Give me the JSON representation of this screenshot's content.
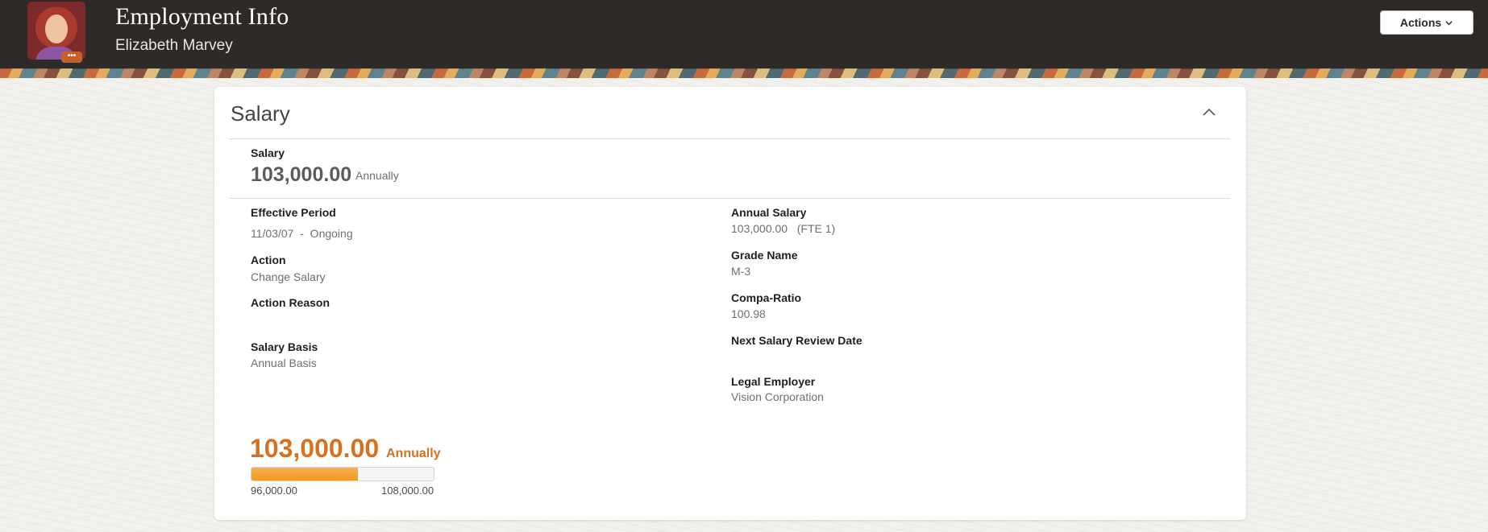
{
  "header": {
    "title": "Employment Info",
    "person_name": "Elizabeth Marvey",
    "actions_label": "Actions",
    "avatar_badge": "•••"
  },
  "section": {
    "title": "Salary",
    "salary_label": "Salary",
    "salary_amount": "103,000.00",
    "salary_frequency": "Annually"
  },
  "details": {
    "effective_period_label": "Effective Period",
    "effective_period_value": "11/03/07  -  Ongoing",
    "action_label": "Action",
    "action_value": "Change Salary",
    "action_reason_label": "Action Reason",
    "salary_basis_label": "Salary Basis",
    "salary_basis_value": "Annual Basis",
    "annual_salary_label": "Annual Salary",
    "annual_salary_value": "103,000.00   (FTE 1)",
    "grade_name_label": "Grade Name",
    "grade_name_value": "M-3",
    "compa_ratio_label": "Compa-Ratio",
    "compa_ratio_value": "100.98",
    "next_review_label": "Next Salary Review Date",
    "legal_employer_label": "Legal Employer",
    "legal_employer_value": "Vision Corporation"
  },
  "range": {
    "amount": "103,000.00",
    "frequency": "Annually",
    "min": "96,000.00",
    "max": "108,000.00",
    "position_fraction": 0.583
  },
  "colors": {
    "header_bg": "#2e2a27",
    "accent_orange": "#d6721f",
    "bar_fill": "#f5a73a"
  }
}
